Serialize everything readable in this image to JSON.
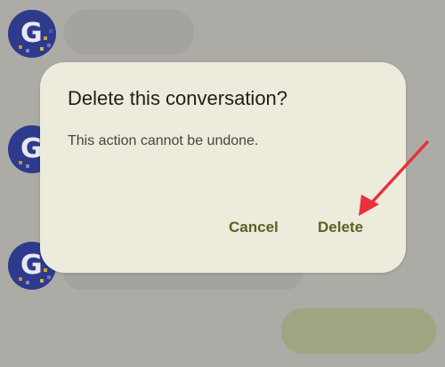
{
  "dialog": {
    "title": "Delete this conversation?",
    "message": "This action cannot be undone.",
    "cancel_label": "Cancel",
    "delete_label": "Delete"
  },
  "avatars": [
    {
      "letter": "G"
    },
    {
      "letter": "G"
    },
    {
      "letter": "G"
    }
  ],
  "colors": {
    "background": "#acaba6",
    "dialog_surface": "#ecebdc",
    "button_text": "#5c6022",
    "avatar": "#2e3a8c",
    "annotation_arrow": "#e8313a",
    "outgoing_bubble": "#9fa582"
  },
  "icons": {
    "annotation": "red-arrow-icon"
  }
}
